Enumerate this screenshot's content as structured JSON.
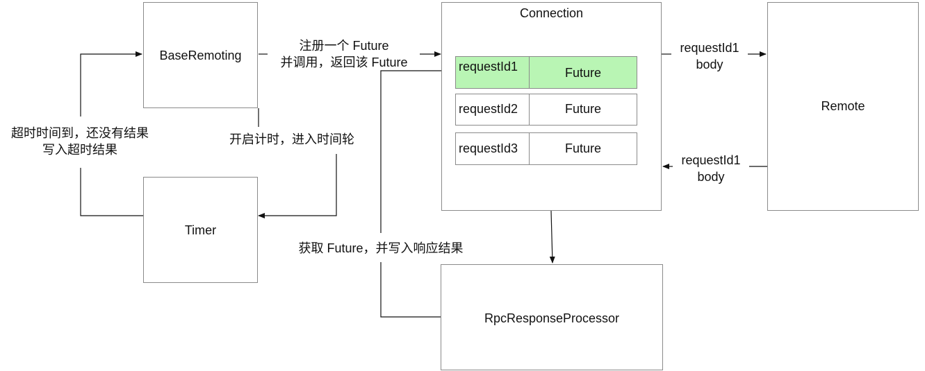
{
  "boxes": {
    "base_remoting": "BaseRemoting",
    "timer": "Timer",
    "connection": "Connection",
    "remote": "Remote",
    "rpc_response_processor": "RpcResponseProcessor"
  },
  "table": [
    {
      "key": "requestId1",
      "value": "Future",
      "highlighted": true
    },
    {
      "key": "requestId2",
      "value": "Future",
      "highlighted": false
    },
    {
      "key": "requestId3",
      "value": "Future",
      "highlighted": false
    }
  ],
  "labels": {
    "register_line1": "注册一个 Future",
    "register_line2": "并调用，返回该 Future",
    "start_timer": "开启计时，进入时间轮",
    "timeout_line1": "超时时间到，还没有结果",
    "timeout_line2": "写入超时结果",
    "fetch_future": "获取 Future，并写入响应结果",
    "request_out_line1": "requestId1",
    "request_out_line2": "body",
    "response_in_line1": "requestId1",
    "response_in_line2": "body"
  },
  "colors": {
    "highlight": "#b9f5b4",
    "border": "#8a8a8a",
    "line": "#111111"
  }
}
